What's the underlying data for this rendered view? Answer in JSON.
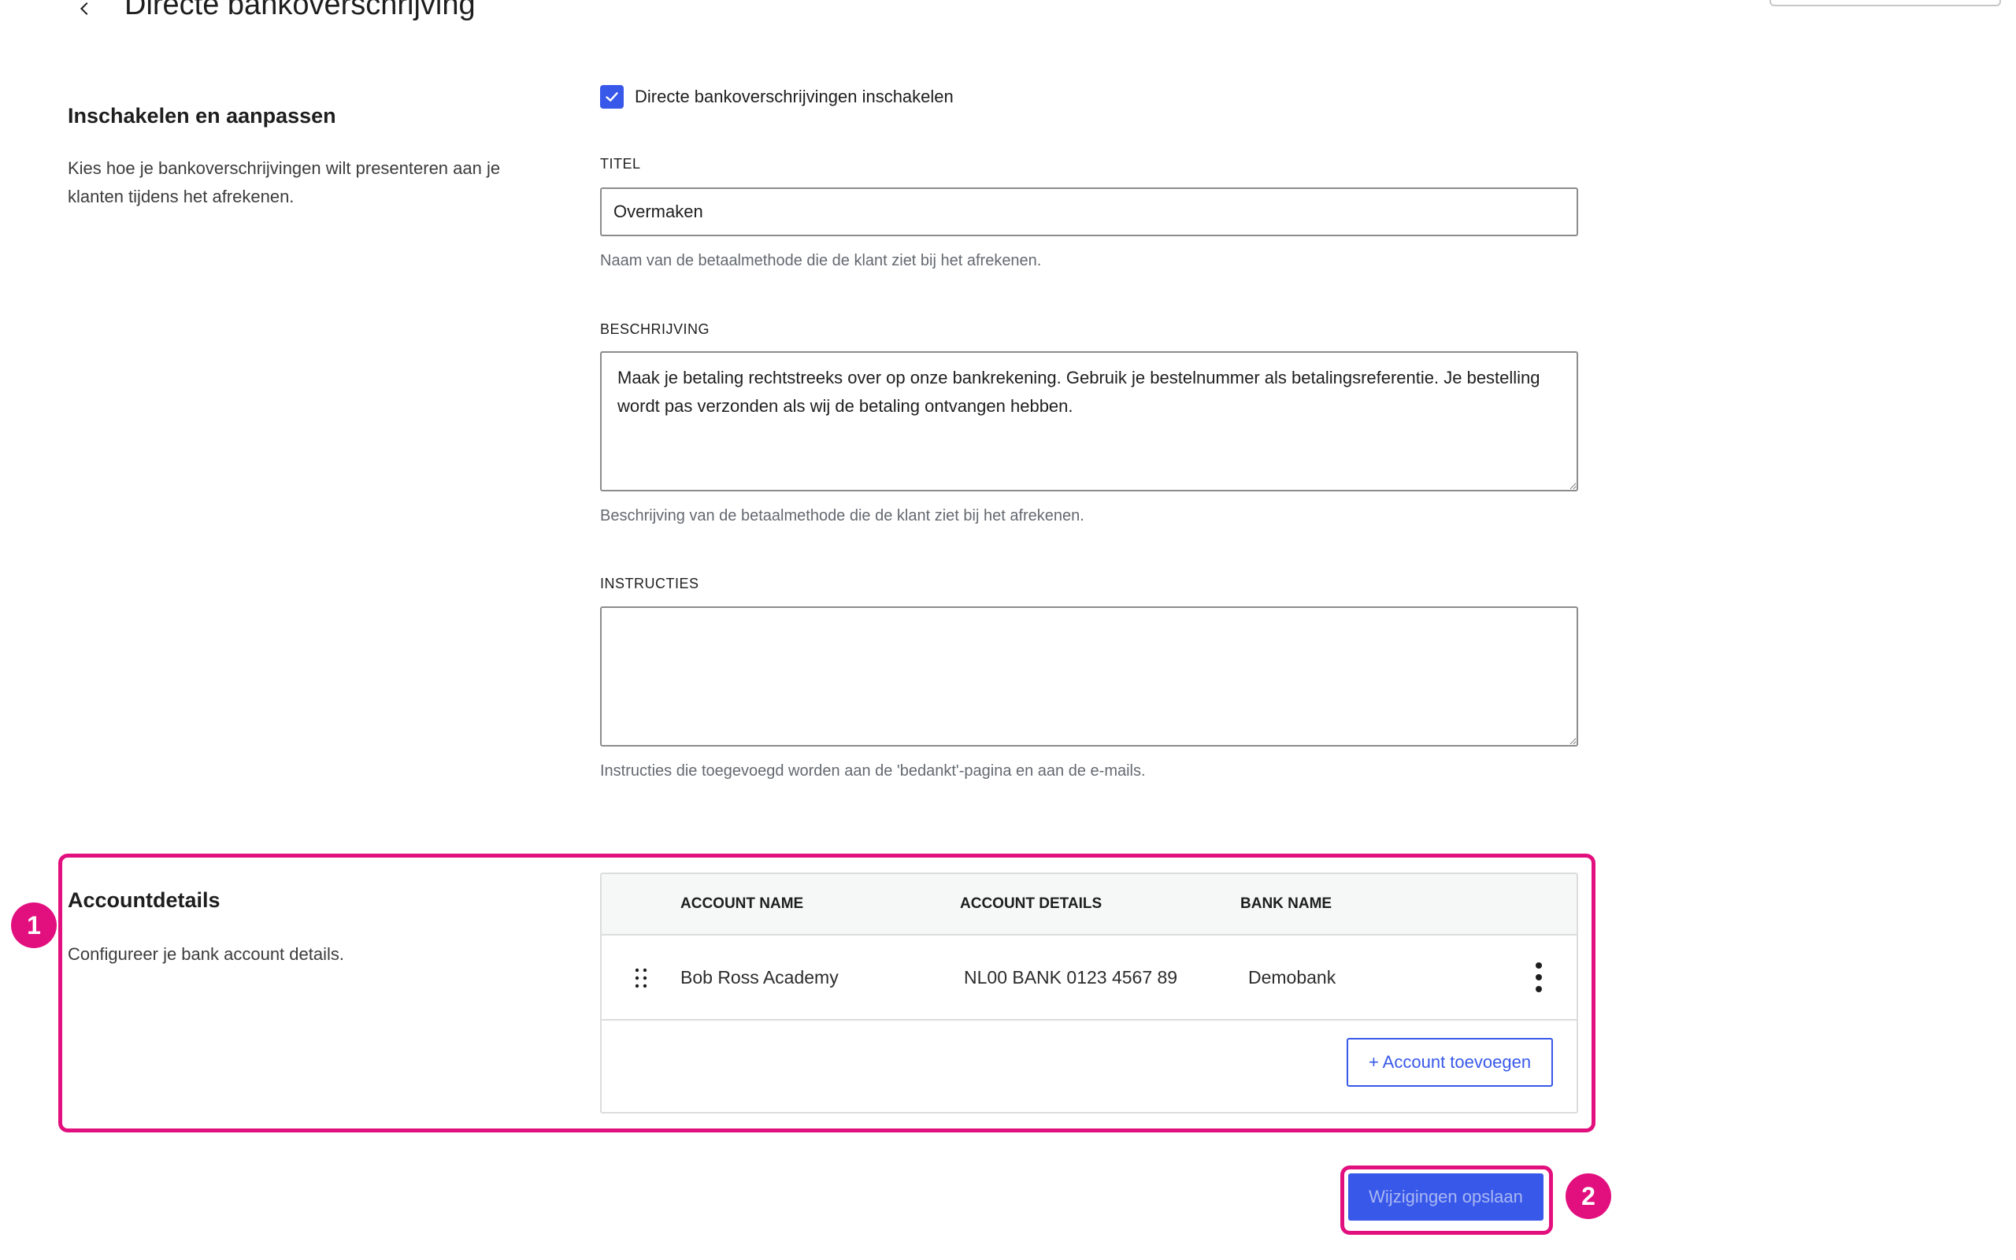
{
  "header": {
    "title": "Directe bankoverschrijving"
  },
  "settings": {
    "heading": "Inschakelen en aanpassen",
    "description": "Kies hoe je bankoverschrijvingen wilt presenteren aan je klanten tijdens het afrekenen.",
    "enable_label": "Directe bankoverschrijvingen inschakelen",
    "enabled": true
  },
  "fields": {
    "title": {
      "label": "TITEL",
      "value": "Overmaken",
      "help": "Naam van de betaalmethode die de klant ziet bij het afrekenen."
    },
    "description": {
      "label": "BESCHRIJVING",
      "value": "Maak je betaling rechtstreeks over op onze bankrekening. Gebruik je bestelnummer als betalingsreferentie. Je bestelling wordt pas verzonden als wij de betaling ontvangen hebben.",
      "help": "Beschrijving van de betaalmethode die de klant ziet bij het afrekenen."
    },
    "instructions": {
      "label": "INSTRUCTIES",
      "value": "",
      "help": "Instructies die toegevoegd worden aan de 'bedankt'-pagina en aan de e-mails."
    }
  },
  "accounts": {
    "heading": "Accountdetails",
    "description": "Configureer je bank account details.",
    "columns": [
      "ACCOUNT NAME",
      "ACCOUNT DETAILS",
      "BANK NAME"
    ],
    "rows": [
      [
        "Bob Ross Academy",
        "NL00 BANK 0123 4567 89",
        "Demobank"
      ]
    ],
    "add_label": "+ Account toevoegen"
  },
  "actions": {
    "save_label": "Wijzigingen opslaan"
  },
  "annotations": {
    "badge_1": "1",
    "badge_2": "2"
  },
  "colors": {
    "accent": "#3858e9",
    "highlight": "#e2107e",
    "help_text": "#646970",
    "border": "#8c8c8c"
  },
  "icons": {
    "back": "chevron-left-icon",
    "checkbox": "checkmark-icon",
    "drag": "drag-handle-icon",
    "more": "more-vertical-icon"
  }
}
